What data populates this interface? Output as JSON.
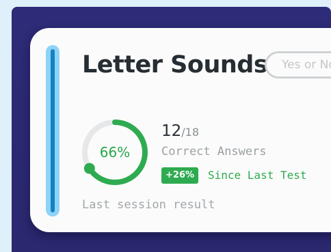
{
  "card": {
    "title": "Letter Sounds",
    "answer_pill": "Yes or No"
  },
  "result": {
    "percent_label": "66%",
    "percent_value": 0.66,
    "correct": "12",
    "separator": "/",
    "total": "18",
    "correct_label": "Correct Answers",
    "delta_badge": "+26%",
    "delta_label": "Since Last Test",
    "session_caption": "Last session result"
  },
  "colors": {
    "accent_blue": "#1282c4",
    "accent_light_blue": "#8ed3f7",
    "success_green": "#2eab50",
    "backdrop_navy": "#2e2b78",
    "ring_track": "#e6e7e8"
  }
}
